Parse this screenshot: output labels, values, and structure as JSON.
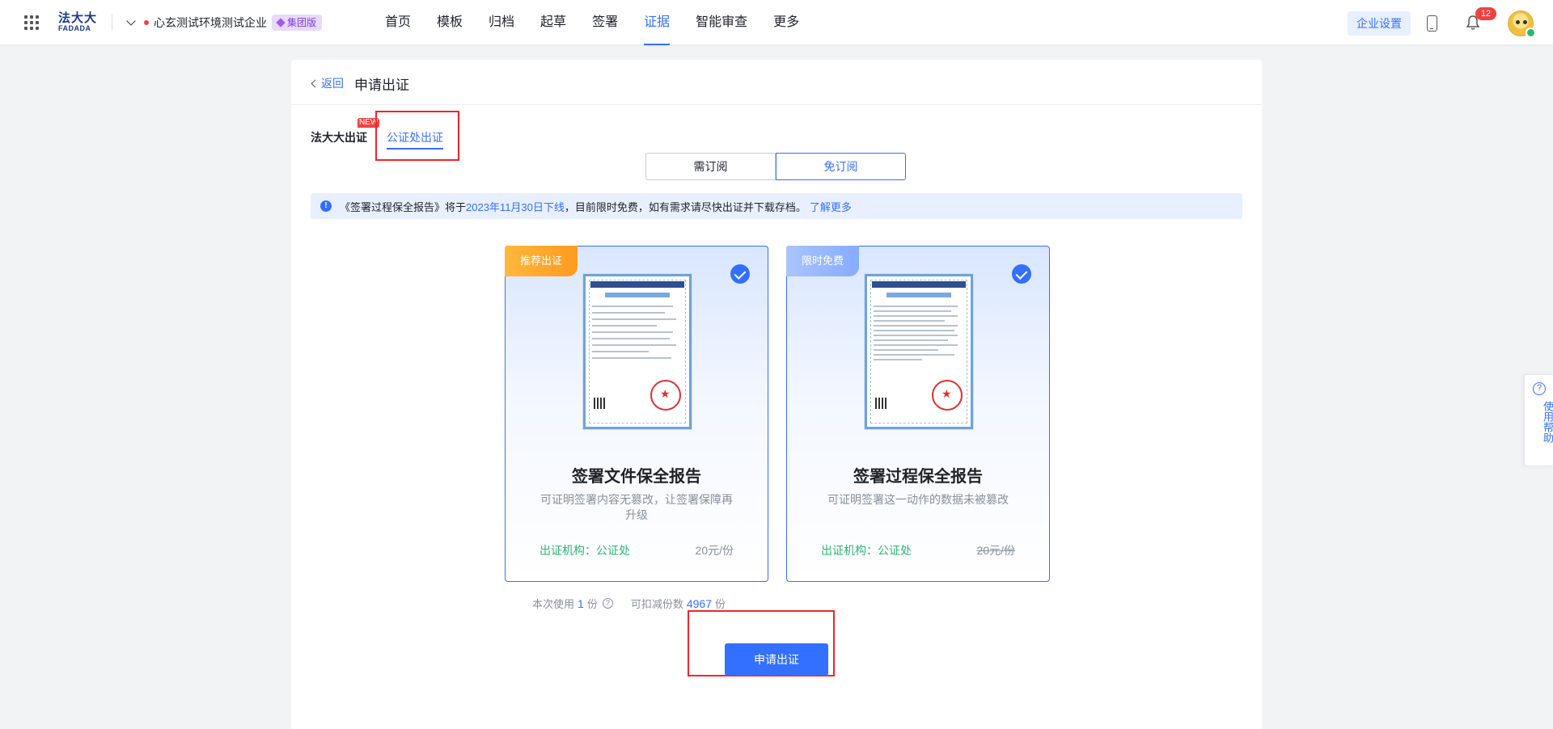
{
  "header": {
    "logo_line1": "法大大",
    "logo_line2": "FADADA",
    "company_name": "心玄测试环境测试企业",
    "edition_badge": "集团版",
    "nav": [
      "首页",
      "模板",
      "归档",
      "起草",
      "签署",
      "证据",
      "智能审查",
      "更多"
    ],
    "active_nav": "证据",
    "settings_label": "企业设置",
    "notification_count": "12"
  },
  "page": {
    "back_label": "返回",
    "title": "申请出证",
    "tabs": {
      "fdd": "法大大出证",
      "new_tag": "NEW",
      "gzc": "公证处出证"
    },
    "subscription": [
      "需订阅",
      "免订阅"
    ],
    "active_subscription": "免订阅",
    "notice": {
      "part1": "《签署过程保全报告》将于",
      "date": "2023年11月30日下线",
      "part2": "，目前限时免费，如有需求请尽快出证并下载存档。",
      "link": "了解更多"
    },
    "options": [
      {
        "corner": "推荐出证",
        "title": "签署文件保全报告",
        "desc": "可证明签署内容无篡改，让签署保障再升级",
        "org": "出证机构：公证处",
        "price": "20元/份",
        "selected": true
      },
      {
        "corner": "限时免费",
        "title": "签署过程保全报告",
        "desc": "可证明签署这一动作的数据未被篡改",
        "org": "出证机构：公证处",
        "price": "20元/份",
        "selected": true
      }
    ],
    "usage": {
      "label1": "本次使用",
      "num1": "1",
      "unit1": "份",
      "label2": "可扣减份数",
      "num2": "4967",
      "unit2": "份"
    },
    "apply_label": "申请出证"
  },
  "help": {
    "label": "使用帮助"
  },
  "colors": {
    "accent": "#3470ff",
    "highlight_box": "#f5222d",
    "success": "#2bb673",
    "warning_corner": "#ff9a1f"
  }
}
